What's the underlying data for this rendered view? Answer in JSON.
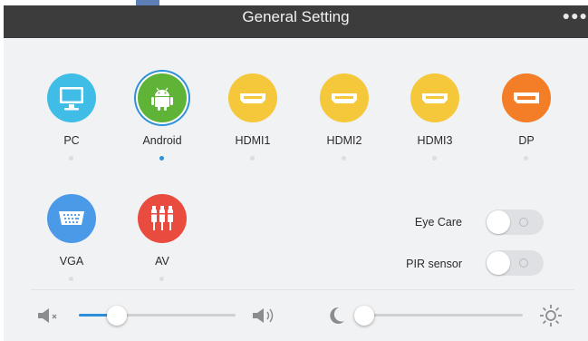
{
  "title": "General Setting",
  "more_icon": "more-dots-icon",
  "sources": [
    {
      "label": "PC",
      "icon": "monitor-icon",
      "color": "#3fbde6",
      "active": false
    },
    {
      "label": "Android",
      "icon": "android-icon",
      "color": "#5fb336",
      "active": true
    },
    {
      "label": "HDMI1",
      "icon": "hdmi-icon",
      "color": "#f5c83b",
      "active": false
    },
    {
      "label": "HDMI2",
      "icon": "hdmi-icon",
      "color": "#f5c83b",
      "active": false
    },
    {
      "label": "HDMI3",
      "icon": "hdmi-icon",
      "color": "#f5c83b",
      "active": false
    },
    {
      "label": "DP",
      "icon": "displayport-icon",
      "color": "#f47d28",
      "active": false
    },
    {
      "label": "VGA",
      "icon": "vga-icon",
      "color": "#4b9ae8",
      "active": false
    },
    {
      "label": "AV",
      "icon": "av-rca-icon",
      "color": "#ea4b3f",
      "active": false
    }
  ],
  "toggles": {
    "eye_care": {
      "label": "Eye Care",
      "on": false
    },
    "pir_sensor": {
      "label": "PIR sensor",
      "on": false
    }
  },
  "volume": {
    "min_icon": "speaker-mute-icon",
    "max_icon": "speaker-loud-icon",
    "level": 0.24
  },
  "brightness": {
    "min_icon": "moon-icon",
    "max_icon": "sun-icon",
    "level": 0.0
  },
  "colors": {
    "accent": "#2d90d8",
    "titlebar": "#3c3c3c",
    "panel": "#f1f2f4"
  }
}
